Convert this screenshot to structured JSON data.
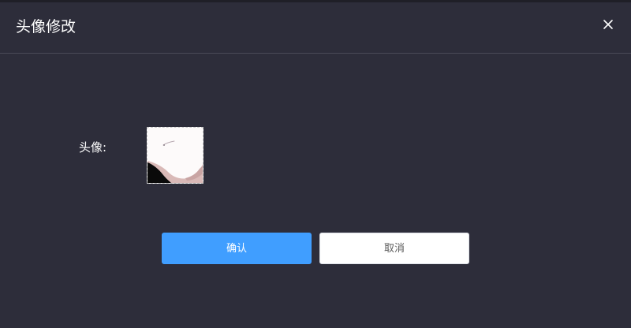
{
  "dialog": {
    "title": "头像修改",
    "close_icon": "close-icon"
  },
  "form": {
    "avatar_label": "头像:"
  },
  "buttons": {
    "confirm_label": "确认",
    "cancel_label": "取消"
  },
  "colors": {
    "background": "#2d2d3a",
    "primary": "#409eff",
    "divider": "#4a4a58"
  }
}
